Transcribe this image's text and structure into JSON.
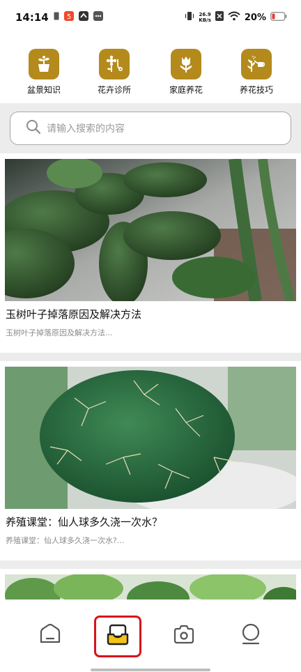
{
  "status_bar": {
    "time": "14:14",
    "net_speed_value": "26.9",
    "net_speed_unit": "KB/s",
    "battery_percent": "20%"
  },
  "categories": [
    {
      "label": "盆景知识",
      "icon": "potted-plant-icon"
    },
    {
      "label": "花卉诊所",
      "icon": "flower-clinic-icon"
    },
    {
      "label": "家庭养花",
      "icon": "tulip-icon"
    },
    {
      "label": "养花技巧",
      "icon": "watering-can-icon"
    }
  ],
  "search": {
    "placeholder": "请输入搜索的内容"
  },
  "articles": [
    {
      "title": "玉树叶子掉落原因及解决方法",
      "summary": "玉树叶子掉落原因及解决方法...",
      "image": "jade-plant-photo"
    },
    {
      "title": "养殖课堂：仙人球多久浇一次水？",
      "summary": "养殖课堂：仙人球多久浇一次水?...",
      "image": "cactus-photo"
    },
    {
      "title": "",
      "summary": "",
      "image": "green-plant-photo"
    }
  ],
  "tabbar": {
    "tabs": [
      {
        "name": "home",
        "icon": "home-icon"
      },
      {
        "name": "articles",
        "icon": "inbox-tray-icon",
        "active": true
      },
      {
        "name": "camera",
        "icon": "camera-icon"
      },
      {
        "name": "profile",
        "icon": "user-icon"
      }
    ]
  },
  "colors": {
    "accent": "#b48a1c",
    "highlight": "#d6141c",
    "divider": "#ececec"
  }
}
